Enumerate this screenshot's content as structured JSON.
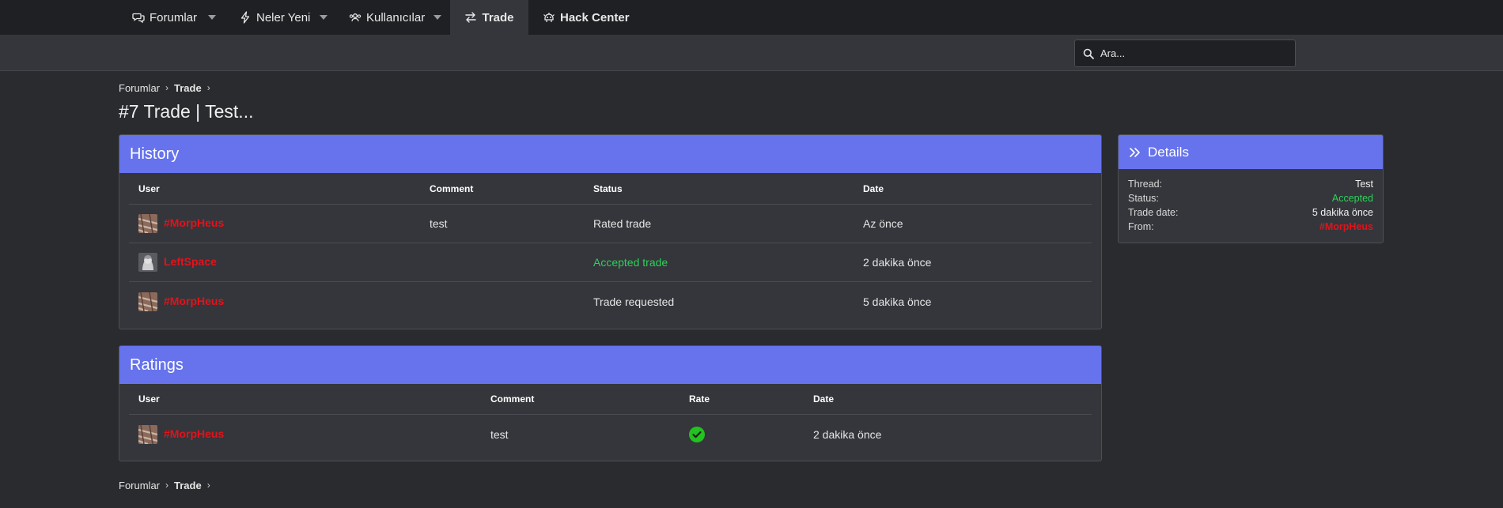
{
  "nav": {
    "items": [
      {
        "label": "Forumlar",
        "icon": "comments-icon"
      },
      {
        "label": "Neler Yeni",
        "icon": "bolt-icon"
      },
      {
        "label": "Kullanıcılar",
        "icon": "users-icon"
      },
      {
        "label": "Trade",
        "icon": "exchange-icon"
      },
      {
        "label": "Hack Center",
        "icon": "hack-icon"
      }
    ]
  },
  "search": {
    "placeholder": "Ara..."
  },
  "breadcrumb": {
    "items": [
      "Forumlar",
      "Trade"
    ]
  },
  "page_title": "#7 Trade | Test...",
  "history": {
    "title": "History",
    "columns": [
      "User",
      "Comment",
      "Status",
      "Date"
    ],
    "rows": [
      {
        "user": "#MorpHeus",
        "comment": "test",
        "status": "Rated trade",
        "date": "Az önce"
      },
      {
        "user": "LeftSpace",
        "comment": "",
        "status": "Accepted trade",
        "date": "2 dakika önce"
      },
      {
        "user": "#MorpHeus",
        "comment": "",
        "status": "Trade requested",
        "date": "5 dakika önce"
      }
    ]
  },
  "ratings": {
    "title": "Ratings",
    "columns": [
      "User",
      "Comment",
      "Rate",
      "Date"
    ],
    "rows": [
      {
        "user": "#MorpHeus",
        "comment": "test",
        "rate": "positive",
        "date": "2 dakika önce"
      }
    ]
  },
  "details": {
    "title": "Details",
    "rows": [
      {
        "label": "Thread:",
        "value": "Test"
      },
      {
        "label": "Status:",
        "value": "Accepted"
      },
      {
        "label": "Trade date:",
        "value": "5 dakika önce"
      },
      {
        "label": "From:",
        "value": "#MorpHeus"
      }
    ]
  },
  "colors": {
    "accent": "#6673ec",
    "username": "#e3121a",
    "success": "#2ed05a",
    "background": "#2a2b2e",
    "panel": "#34363b"
  }
}
